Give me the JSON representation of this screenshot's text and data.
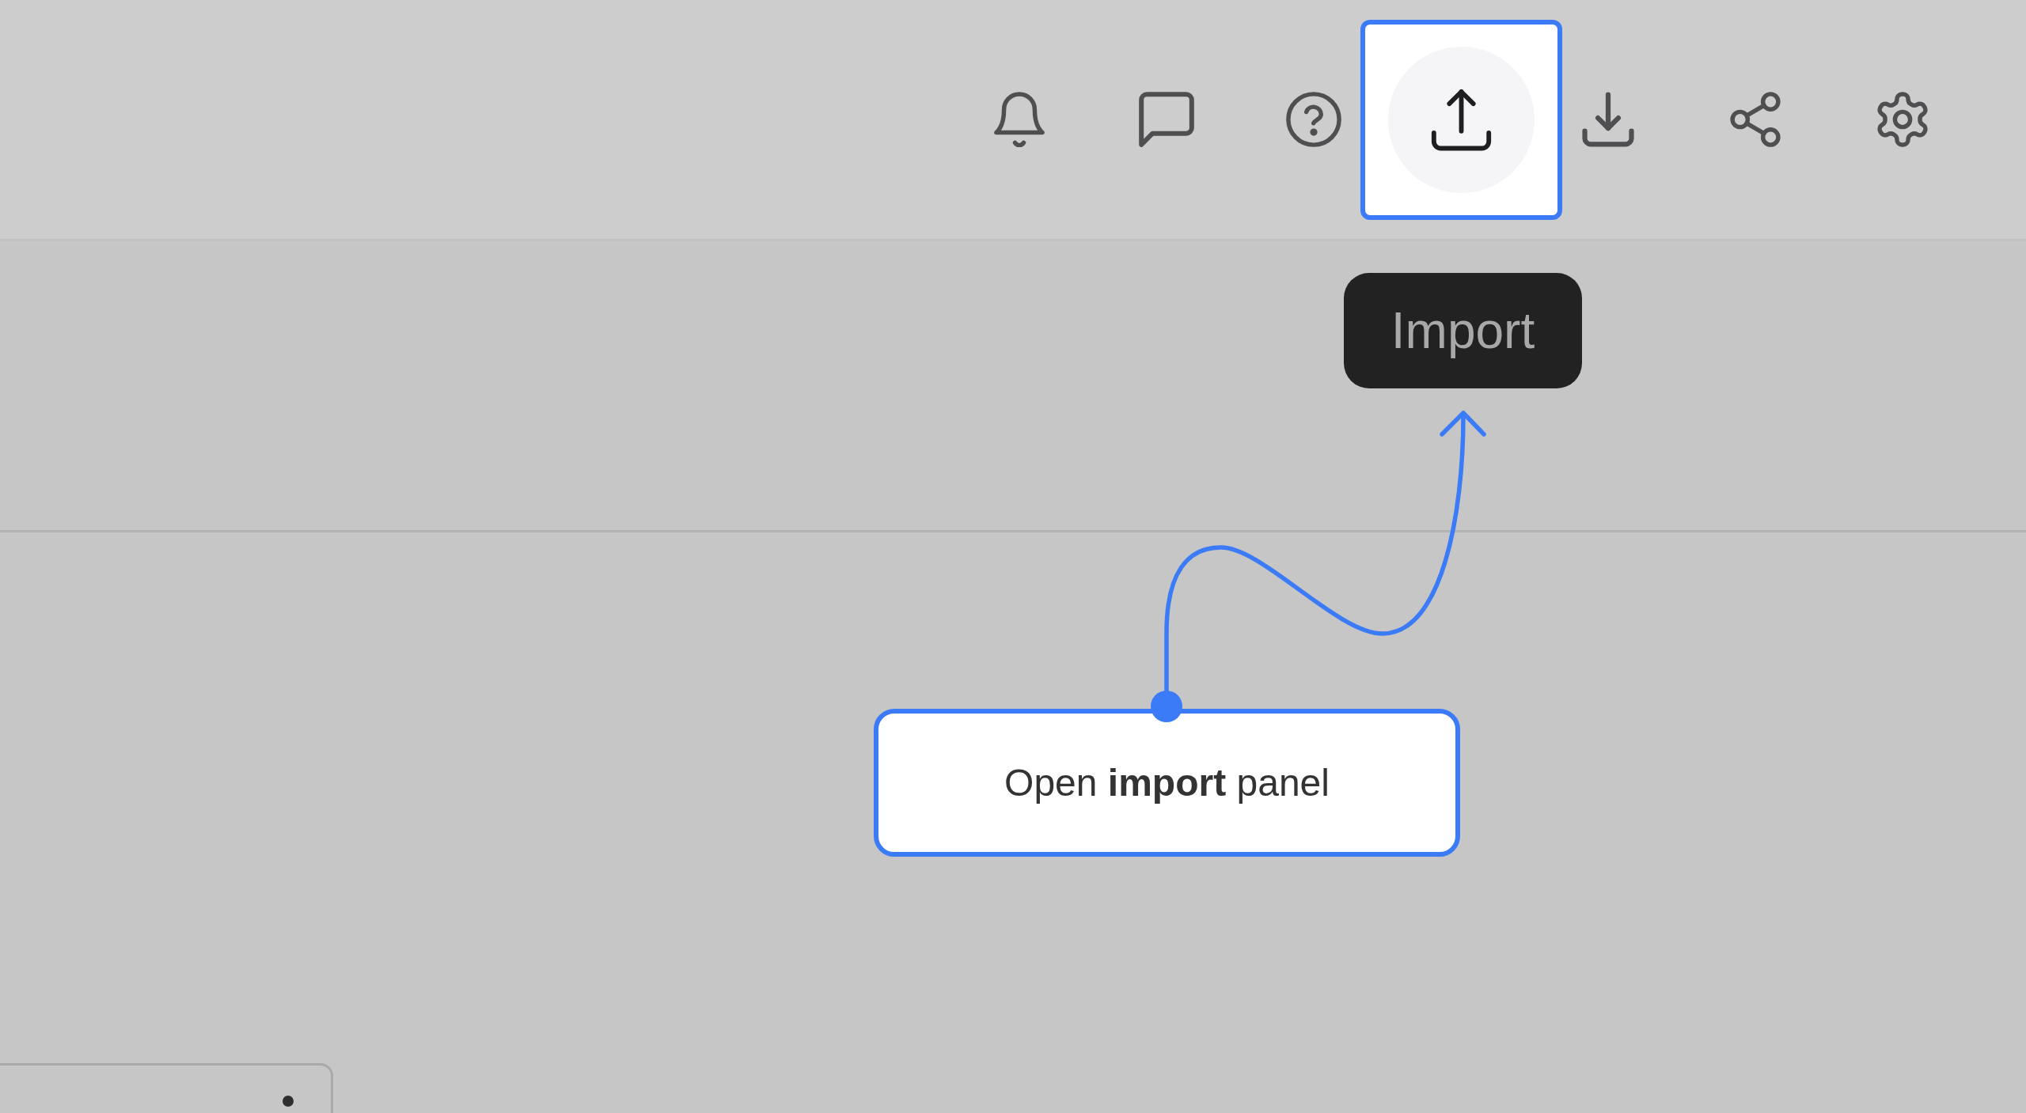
{
  "toolbar": {
    "buttons": [
      {
        "kind": "bell",
        "highlighted": false
      },
      {
        "kind": "chat",
        "highlighted": false
      },
      {
        "kind": "help",
        "highlighted": false
      },
      {
        "kind": "upload",
        "highlighted": true
      },
      {
        "kind": "download",
        "highlighted": false
      },
      {
        "kind": "share",
        "highlighted": false
      },
      {
        "kind": "settings",
        "highlighted": false
      }
    ]
  },
  "tooltip": {
    "text": "Import"
  },
  "callout": {
    "text": "Open **import** panel"
  }
}
